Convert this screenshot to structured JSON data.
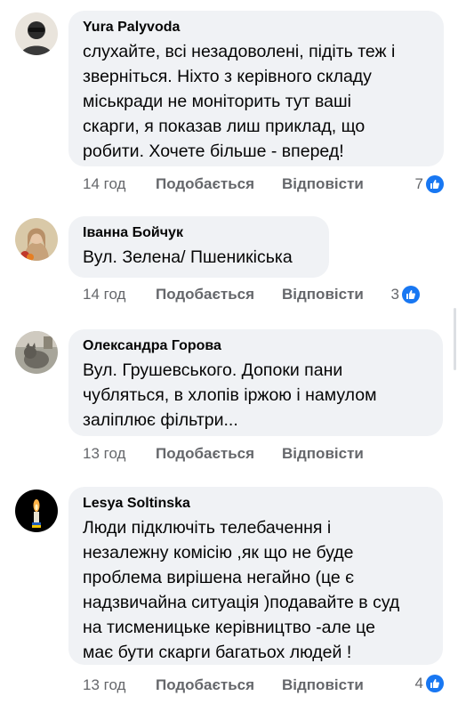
{
  "comments": [
    {
      "author": "Yura Palyvoda",
      "text": "слухайте, всі незадоволені, підіть теж і\nзверніться. Ніхто з керівного складу\nміськради не моніторить тут ваші\nскарги, я показав лиш приклад, що\nробити. Хочете більше - вперед!",
      "time": "14 год",
      "like_label": "Подобається",
      "reply_label": "Відповісти",
      "reactions": "7",
      "reaction_icon": "like-icon"
    },
    {
      "author": "Іванна Бойчук",
      "text": "Вул. Зелена/ Пшеникіська",
      "time": "14 год",
      "like_label": "Подобається",
      "reply_label": "Відповісти",
      "reactions": "3",
      "reaction_icon": "like-icon"
    },
    {
      "author": "Олександра Горова",
      "text": "Вул. Грушевського. Допоки пани\nчубляться, в хлопів іржою  і намулом\nзаліплює фільтри...",
      "time": "13 год",
      "like_label": "Подобається",
      "reply_label": "Відповісти"
    },
    {
      "author": "Lesya Soltinska",
      "text": "Люди підключіть телебачення і\nнезалежну комісію ,як що не буде\nпроблема вирішена негайно (це є\nнадзвичайна ситуація )подавайте в суд\nна тисменицьке керівництво -але це\nмає бути скарги багатьох людей !",
      "time": "13 год",
      "like_label": "Подобається",
      "reply_label": "Відповісти",
      "reactions": "4",
      "reaction_icon": "like-icon"
    }
  ],
  "colors": {
    "bubble": "#f0f2f5",
    "meta_text": "#65676b",
    "like_blue": "#1877f2"
  }
}
